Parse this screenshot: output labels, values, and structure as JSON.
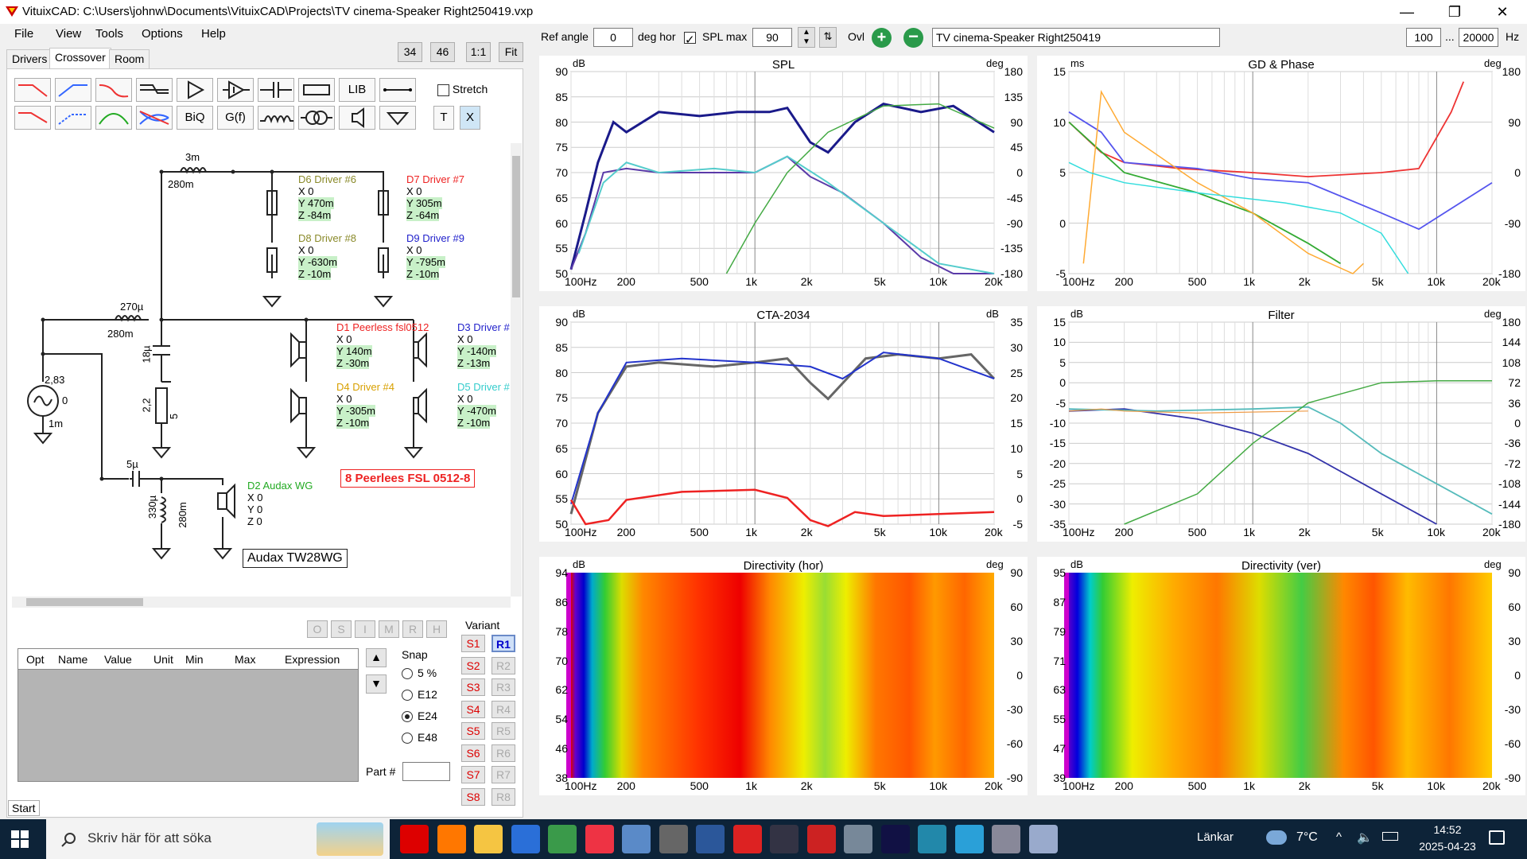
{
  "window": {
    "title": "VituixCAD: C:\\Users\\johnw\\Documents\\VituixCAD\\Projects\\TV cinema-Speaker Right250419.vxp",
    "minimize": "—",
    "maximize": "❐",
    "close": "✕"
  },
  "menu": [
    "File",
    "View",
    "Tools",
    "Options",
    "Help"
  ],
  "zoom_buttons": [
    "34",
    "46",
    "1:1",
    "Fit"
  ],
  "tabs": [
    "Drivers",
    "Crossover",
    "Room"
  ],
  "toolbar": {
    "lib": "LIB",
    "biq": "BiQ",
    "gf": "G(f)",
    "t": "T",
    "x": "X",
    "stretch": "Stretch"
  },
  "top": {
    "ref_angle_label": "Ref angle",
    "ref_angle": "0",
    "deg_hor": "deg hor",
    "spl_max_label": "SPL max",
    "spl_max": "90",
    "ovl": "Ovl",
    "project": "TV cinema-Speaker Right250419",
    "f_min": "100",
    "dots": "...",
    "f_max": "20000",
    "hz": "Hz"
  },
  "schematic": {
    "c3m": "3m",
    "r280a": "280m",
    "l270": "270µ",
    "r280b": "280m",
    "c18": "18µ",
    "r22": "2,2",
    "r5": "5",
    "gen": "2,83",
    "gen0": "0",
    "gen1m": "1m",
    "c5": "5µ",
    "l330": "330µ",
    "r280c": "280m",
    "d6": {
      "name": "D6 Driver #6",
      "x": "X 0",
      "y": "Y 470m",
      "z": "Z -84m"
    },
    "d7": {
      "name": "D7 Driver #7",
      "x": "X 0",
      "y": "Y 305m",
      "z": "Z -64m"
    },
    "d8": {
      "name": "D8 Driver #8",
      "x": "X 0",
      "y": "Y -630m",
      "z": "Z -10m"
    },
    "d9": {
      "name": "D9 Driver #9",
      "x": "X 0",
      "y": "Y -795m",
      "z": "Z -10m"
    },
    "d1": {
      "name": "D1 Peerless fsl0512",
      "x": "X 0",
      "y": "Y 140m",
      "z": "Z -30m"
    },
    "d3": {
      "name": "D3 Driver #",
      "x": "X 0",
      "y": "Y -140m",
      "z": "Z -13m"
    },
    "d4": {
      "name": "D4 Driver #4",
      "x": "X 0",
      "y": "Y -305m",
      "z": "Z -10m"
    },
    "d5": {
      "name": "D5 Driver #",
      "x": "X 0",
      "y": "Y -470m",
      "z": "Z -10m"
    },
    "d2": {
      "name": "D2 Audax WG",
      "x": "X 0",
      "y": "Y 0",
      "z": "Z 0"
    },
    "note1": "8 Peerlees FSL 0512-8",
    "note2": "Audax TW28WG"
  },
  "opt_buttons": [
    "O",
    "S",
    "I",
    "M",
    "R",
    "H"
  ],
  "table_headers": [
    "Opt",
    "Name",
    "Value",
    "Unit",
    "Min",
    "Max",
    "Expression"
  ],
  "snap": {
    "label": "Snap",
    "options": [
      "5 %",
      "E12",
      "E24",
      "E48"
    ],
    "selected": "E24"
  },
  "part_label": "Part #",
  "variant": {
    "label": "Variant",
    "s": [
      "S1",
      "S2",
      "S3",
      "S4",
      "S5",
      "S6",
      "S7",
      "S8"
    ],
    "r": [
      "R1",
      "R2",
      "R3",
      "R4",
      "R5",
      "R6",
      "R7",
      "R8"
    ],
    "selected": "R1"
  },
  "start_label": "Start",
  "charts": {
    "spl": {
      "title": "SPL",
      "ul": "dB",
      "ur": "deg",
      "yl": [
        "90",
        "85",
        "80",
        "75",
        "70",
        "65",
        "60",
        "55",
        "50"
      ],
      "yr": [
        "180",
        "135",
        "90",
        "45",
        "0",
        "-45",
        "-90",
        "-135",
        "-180"
      ],
      "x": [
        "100Hz",
        "200",
        "500",
        "1k",
        "2k",
        "5k",
        "10k",
        "20k"
      ]
    },
    "gd": {
      "title": "GD & Phase",
      "ul": "ms",
      "ur": "deg",
      "yl": [
        "15",
        "10",
        "5",
        "0",
        "-5"
      ],
      "yr": [
        "180",
        "90",
        "0",
        "-90",
        "-180"
      ],
      "x": [
        "100Hz",
        "200",
        "500",
        "1k",
        "2k",
        "5k",
        "10k",
        "20k"
      ]
    },
    "cta": {
      "title": "CTA-2034",
      "ul": "dB",
      "ur": "dB",
      "yl": [
        "90",
        "85",
        "80",
        "75",
        "70",
        "65",
        "60",
        "55",
        "50"
      ],
      "yr": [
        "35",
        "30",
        "25",
        "20",
        "15",
        "10",
        "5",
        "0",
        "-5"
      ],
      "x": [
        "100Hz",
        "200",
        "500",
        "1k",
        "2k",
        "5k",
        "10k",
        "20k"
      ]
    },
    "filter": {
      "title": "Filter",
      "ul": "dB",
      "ur": "deg",
      "yl": [
        "15",
        "10",
        "5",
        "0",
        "-5",
        "-10",
        "-15",
        "-20",
        "-25",
        "-30",
        "-35"
      ],
      "yr": [
        "180",
        "144",
        "108",
        "72",
        "36",
        "0",
        "-36",
        "-72",
        "-108",
        "-144",
        "-180"
      ],
      "x": [
        "100Hz",
        "200",
        "500",
        "1k",
        "2k",
        "5k",
        "10k",
        "20k"
      ]
    },
    "dirh": {
      "title": "Directivity (hor)",
      "ul": "dB",
      "ur": "deg",
      "yl": [
        "94",
        "86",
        "78",
        "70",
        "62",
        "54",
        "46",
        "38"
      ],
      "yr": [
        "90",
        "60",
        "30",
        "0",
        "-30",
        "-60",
        "-90"
      ],
      "x": [
        "100Hz",
        "200",
        "500",
        "1k",
        "2k",
        "5k",
        "10k",
        "20k"
      ]
    },
    "dirv": {
      "title": "Directivity (ver)",
      "ul": "dB",
      "ur": "deg",
      "yl": [
        "95",
        "87",
        "79",
        "71",
        "63",
        "55",
        "47",
        "39"
      ],
      "yr": [
        "90",
        "60",
        "30",
        "0",
        "-30",
        "-60",
        "-90"
      ],
      "x": [
        "100Hz",
        "200",
        "500",
        "1k",
        "2k",
        "5k",
        "10k",
        "20k"
      ]
    }
  },
  "taskbar": {
    "search": "Skriv här för att söka",
    "links": "Länkar",
    "temp": "7°C",
    "time": "14:52",
    "date": "2025-04-23"
  }
}
